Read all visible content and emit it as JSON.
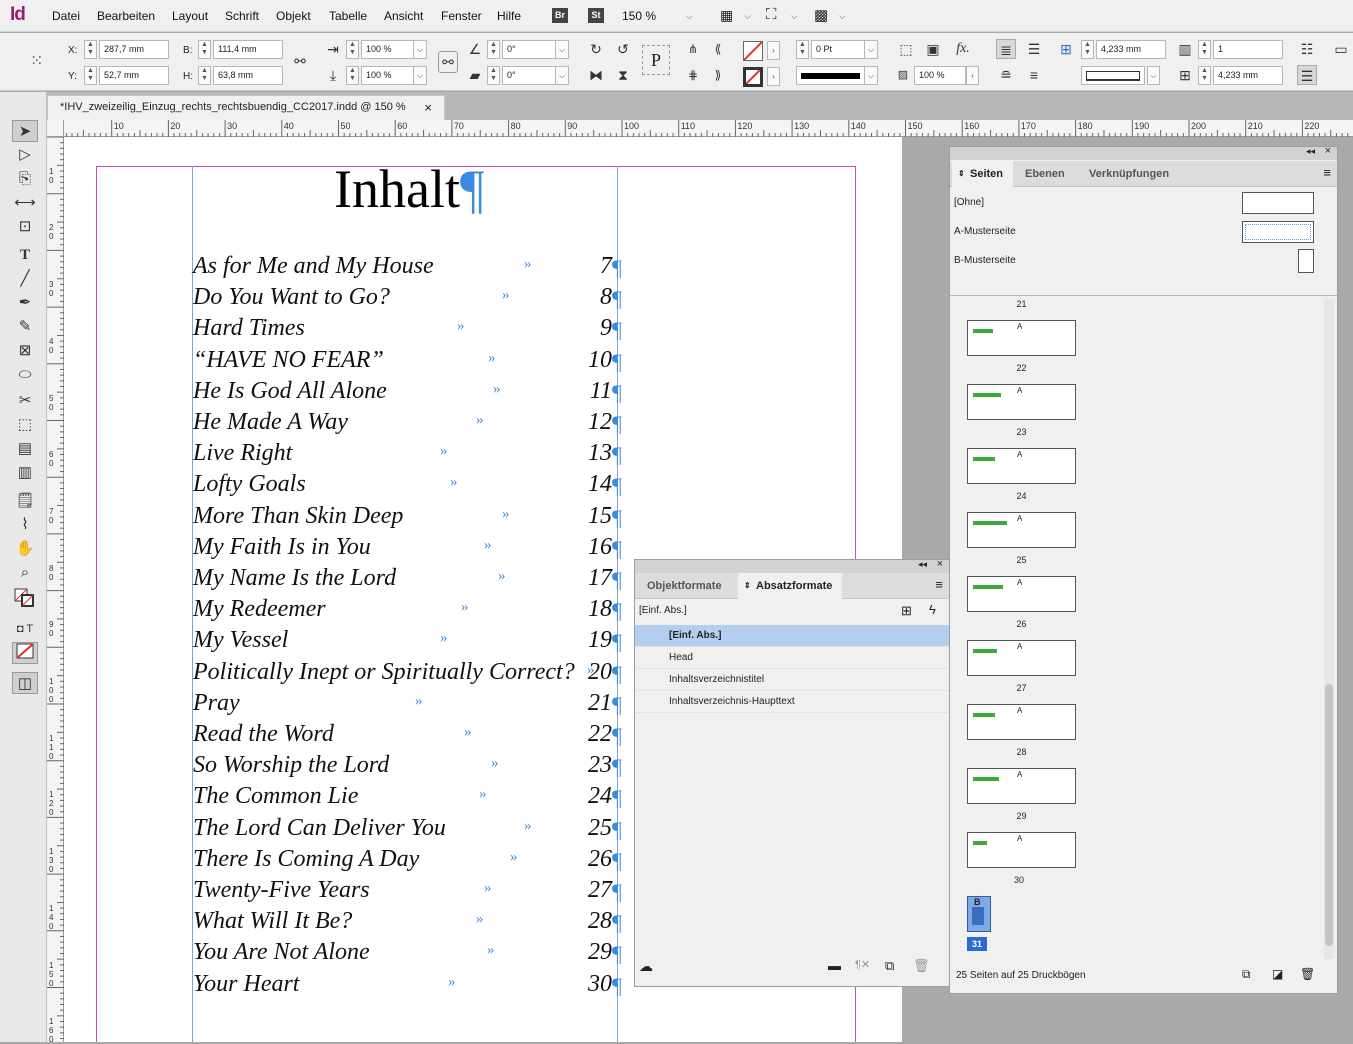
{
  "app": {
    "logo": "Id"
  },
  "menu": [
    "Datei",
    "Bearbeiten",
    "Layout",
    "Schrift",
    "Objekt",
    "Tabelle",
    "Ansicht",
    "Fenster",
    "Hilfe"
  ],
  "bridge": {
    "br": "Br",
    "st": "St",
    "zoom": "150 %"
  },
  "control": {
    "x_label": "X:",
    "x_value": "287,7 mm",
    "y_label": "Y:",
    "y_value": "52,7 mm",
    "b_label": "B:",
    "b_value": "111,4 mm",
    "h_label": "H:",
    "h_value": "63,8 mm",
    "scale_x": "100 %",
    "scale_y": "100 %",
    "rotation": "0°",
    "shear": "0°",
    "stroke_weight": "0 Pt",
    "opacity": "100 %",
    "gutter1": "4,233 mm",
    "gutter2": "4,233 mm",
    "columns": "1"
  },
  "document_tab": {
    "title": "*IHV_zweizeilig_Einzug_rechts_rechtsbuendig_CC2017.indd @ 150 %",
    "close": "×"
  },
  "hruler": [
    "10",
    "20",
    "30",
    "40",
    "50",
    "60",
    "70",
    "80",
    "90",
    "100",
    "110",
    "120",
    "130",
    "140",
    "150",
    "160",
    "170",
    "180",
    "190",
    "200",
    "210",
    "220"
  ],
  "vruler": [
    "1\n0",
    "2\n0",
    "3\n0",
    "4\n0",
    "5\n0",
    "6\n0",
    "7\n0",
    "8\n0",
    "9\n0",
    "1\n0\n0",
    "1\n1\n0",
    "1\n2\n0",
    "1\n3\n0",
    "1\n4\n0",
    "1\n5\n0",
    "1\n6\n0"
  ],
  "document": {
    "heading": "Inhalt",
    "pilcrow": "¶",
    "tab_glyph": "»",
    "toc": [
      {
        "title": "As for Me and My House",
        "page": "7"
      },
      {
        "title": "Do You Want to Go?",
        "page": "8"
      },
      {
        "title": "Hard Times",
        "page": "9"
      },
      {
        "title": "“HAVE NO FEAR”",
        "page": "10"
      },
      {
        "title": "He Is God All Alone",
        "page": "11"
      },
      {
        "title": "He Made A Way",
        "page": "12"
      },
      {
        "title": "Live Right",
        "page": "13"
      },
      {
        "title": "Lofty Goals",
        "page": "14"
      },
      {
        "title": "More Than Skin Deep",
        "page": "15"
      },
      {
        "title": "My Faith Is in You",
        "page": "16"
      },
      {
        "title": "My Name Is the Lord",
        "page": "17"
      },
      {
        "title": "My Redeemer",
        "page": "18"
      },
      {
        "title": "My Vessel",
        "page": "19"
      },
      {
        "title": "Politically Inept or Spiritually Correct?",
        "page": "20"
      },
      {
        "title": "Pray",
        "page": "21"
      },
      {
        "title": "Read the Word",
        "page": "22"
      },
      {
        "title": "So Worship the Lord",
        "page": "23"
      },
      {
        "title": "The Common Lie",
        "page": "24"
      },
      {
        "title": "The Lord Can Deliver You",
        "page": "25"
      },
      {
        "title": "There Is Coming A Day",
        "page": "26"
      },
      {
        "title": "Twenty-Five Years",
        "page": "27"
      },
      {
        "title": "What Will It Be?",
        "page": "28"
      },
      {
        "title": "You Are Not Alone",
        "page": "29"
      },
      {
        "title": "Your Heart",
        "page": "30"
      }
    ]
  },
  "styles_panel": {
    "tab_objekt": "Objektformate",
    "tab_absatz": "Absatzformate",
    "current": "[Einf. Abs.]",
    "items": [
      "[Einf. Abs.]",
      "Head",
      "Inhaltsverzeichnistitel",
      "Inhaltsverzeichnis-Haupttext"
    ]
  },
  "pages_panel": {
    "tab_seiten": "Seiten",
    "tab_ebenen": "Ebenen",
    "tab_verknuepfungen": "Verknüpfungen",
    "masters": [
      "[Ohne]",
      "A-Musterseite",
      "B-Musterseite"
    ],
    "pages": [
      "21",
      "22",
      "23",
      "24",
      "25",
      "26",
      "27",
      "28",
      "29",
      "30"
    ],
    "master_letter": "A",
    "last_master": "B",
    "last_page": "31",
    "status": "25 Seiten auf 25 Druckbögen"
  }
}
